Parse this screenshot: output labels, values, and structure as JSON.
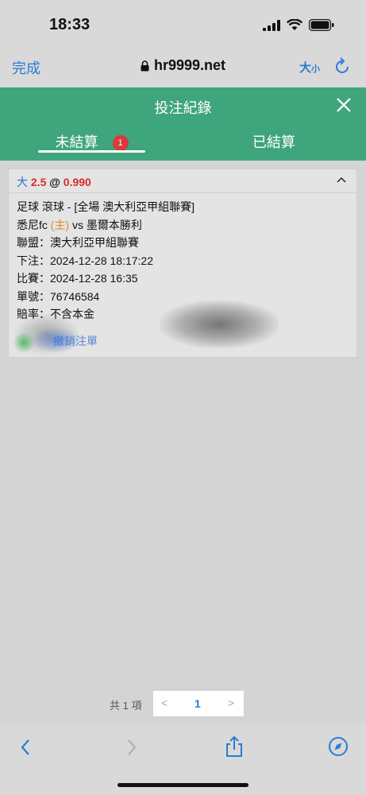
{
  "status": {
    "time": "18:33"
  },
  "browser": {
    "done_label": "完成",
    "url": "hr9999.net",
    "size_label_big": "大",
    "size_label_small": "小"
  },
  "header": {
    "title": "投注紀錄",
    "tabs": [
      {
        "label": "未結算",
        "badge": "1",
        "active": true
      },
      {
        "label": "已結算",
        "active": false
      }
    ]
  },
  "bet": {
    "selection": "大",
    "handicap": "2.5",
    "at": "@",
    "odds": "0.990",
    "line1": "足球 滾球 - [全場 澳大利亞甲組聯賽]",
    "team_home": "悉尼fc",
    "home_tag": "(主)",
    "vs_text": "vs 墨爾本勝利",
    "league_label": "聯盟：澳大利亞甲組聯賽",
    "bet_time_label": "下注：2024-12-28 18:17:22",
    "match_time_label": "比賽：2024-12-28 16:35",
    "ticket_label": "單號：76746584",
    "odds_type_label": "賠率：不含本金",
    "cancel_link": "撤銷注單"
  },
  "pager": {
    "total": "共 1 項",
    "prev": "<",
    "current": "1",
    "next": ">"
  },
  "colors": {
    "accent": "#3fa57c",
    "link": "#2a7bd6",
    "red": "#d92a2a",
    "badge": "#d93a3a"
  },
  "icons": [
    "signal-icon",
    "wifi-icon",
    "battery-icon",
    "lock-icon",
    "reload-icon",
    "close-icon",
    "chevron-up-icon",
    "back-icon",
    "forward-icon",
    "share-icon",
    "compass-icon"
  ]
}
